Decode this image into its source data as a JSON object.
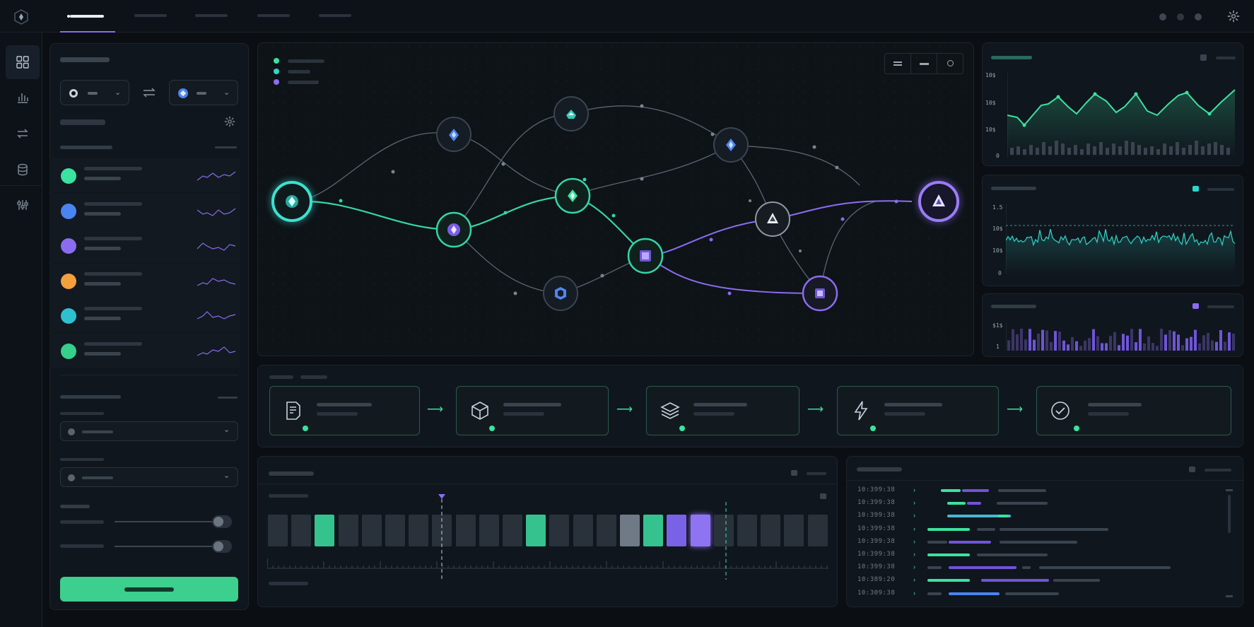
{
  "theme": {
    "accent_green": "#3be2a0",
    "accent_teal": "#2fd6c8",
    "accent_purple": "#8b6cf0",
    "accent_blue": "#4a84f0",
    "accent_orange": "#f4a03c",
    "bg": "#0b0f14"
  },
  "rail": {
    "items": [
      {
        "icon": "grid-icon",
        "active": true
      },
      {
        "icon": "bar-chart-icon",
        "active": false
      },
      {
        "icon": "swap-icon",
        "active": false
      },
      {
        "icon": "database-icon",
        "active": false
      },
      {
        "icon": "sliders-icon",
        "active": false
      }
    ]
  },
  "header": {
    "logo": "hexagon-logo-icon",
    "active_tab_index": 0,
    "tab_count": 5
  },
  "sidebar": {
    "assets": [
      {
        "color": "#3be2a0"
      },
      {
        "color": "#4a84f0"
      },
      {
        "color": "#8b6cf0"
      },
      {
        "color": "#f4a03c"
      },
      {
        "color": "#2fc0d0"
      },
      {
        "color": "#34d08c"
      }
    ],
    "sliders": [
      {
        "value": 0.92
      },
      {
        "value": 0.92
      }
    ]
  },
  "graph": {
    "legend_colors": [
      "#3be2a0",
      "#2fd6c8",
      "#8b6cf0"
    ]
  },
  "charts": {
    "line_chart": {
      "y_ticks": [
        "10$",
        "10$",
        "10$",
        "0"
      ]
    },
    "noise_chart": {
      "y_ticks": [
        "1.5",
        "10$",
        "10$",
        "0"
      ]
    },
    "bar_chart": {
      "y_ticks": [
        "$1$",
        "1"
      ]
    }
  },
  "pipeline": {
    "stages": [
      {
        "icon": "document-icon"
      },
      {
        "icon": "cube-icon"
      },
      {
        "icon": "layers-icon"
      },
      {
        "icon": "lightning-icon"
      },
      {
        "icon": "check-circle-icon"
      }
    ]
  },
  "timeline": {
    "cells": [
      "n",
      "n",
      "g",
      "n",
      "n",
      "n",
      "n",
      "n",
      "n",
      "n",
      "n",
      "g",
      "n",
      "n",
      "n",
      "l",
      "g",
      "p",
      "p",
      "n",
      "n",
      "n",
      "n",
      "n"
    ]
  },
  "log": {
    "lines": [
      {
        "time": "10:399:38"
      },
      {
        "time": "10:399:38"
      },
      {
        "time": "10:399:38"
      },
      {
        "time": "10:399:38"
      },
      {
        "time": "10:399:38"
      },
      {
        "time": "10:399:38"
      },
      {
        "time": "10:399:38"
      },
      {
        "time": "10:389:20"
      },
      {
        "time": "10:309:38"
      }
    ]
  }
}
